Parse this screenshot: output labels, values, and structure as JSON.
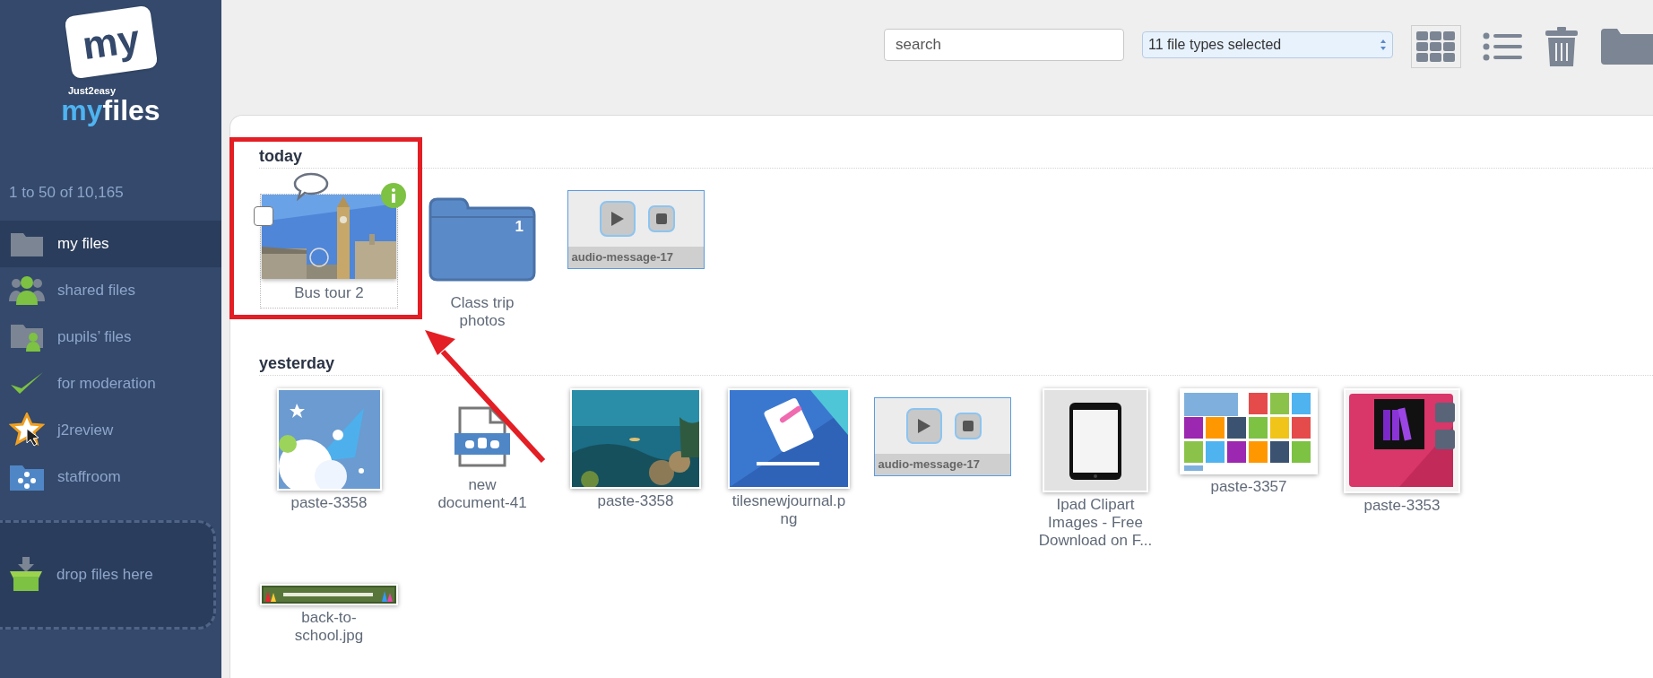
{
  "logo": {
    "badge": "my",
    "brand": "Just2easy",
    "name_first": "my",
    "name_second": "files"
  },
  "count": "1 to 50 of 10,165",
  "nav": [
    {
      "kind": "folder",
      "label": "my files",
      "selected": true
    },
    {
      "kind": "shared",
      "label": "shared files",
      "selected": false
    },
    {
      "kind": "pupils",
      "label": "pupils’ files",
      "selected": false
    },
    {
      "kind": "moderation",
      "label": "for moderation",
      "selected": false
    },
    {
      "kind": "review",
      "label": "j2review",
      "selected": false
    },
    {
      "kind": "staffroom",
      "label": "staffroom",
      "selected": false
    }
  ],
  "dropzone": {
    "label": "drop files here"
  },
  "toolbar": {
    "search": {
      "placeholder": "search"
    },
    "filter": {
      "value": "11 file types selected"
    },
    "views": [
      {
        "kind": "grid",
        "selected": true
      },
      {
        "kind": "list",
        "selected": false
      }
    ]
  },
  "sections": [
    {
      "title": "today",
      "items": [
        {
          "kind": "picture",
          "label": "Bus tour 2",
          "highlighted": true,
          "checked": false,
          "comment": true,
          "info": true
        },
        {
          "kind": "folder",
          "label": "Class trip photos",
          "count": "1"
        },
        {
          "kind": "audio",
          "label": "audio-message-17"
        }
      ]
    },
    {
      "title": "yesterday",
      "items": [
        {
          "kind": "picture",
          "label": "paste-3358"
        },
        {
          "kind": "document",
          "label": "new document-41"
        },
        {
          "kind": "picture",
          "label": "paste-3358"
        },
        {
          "kind": "picture",
          "label": "tilesnewjournal.png"
        },
        {
          "kind": "audio",
          "label": "audio-message-17"
        },
        {
          "kind": "picture",
          "label": "Ipad Clipart Images - Free Download on F..."
        },
        {
          "kind": "picture",
          "label": "paste-3357"
        },
        {
          "kind": "picture",
          "label": "paste-3353"
        },
        {
          "kind": "picture",
          "label": "back-to-school.jpg"
        }
      ]
    }
  ]
}
